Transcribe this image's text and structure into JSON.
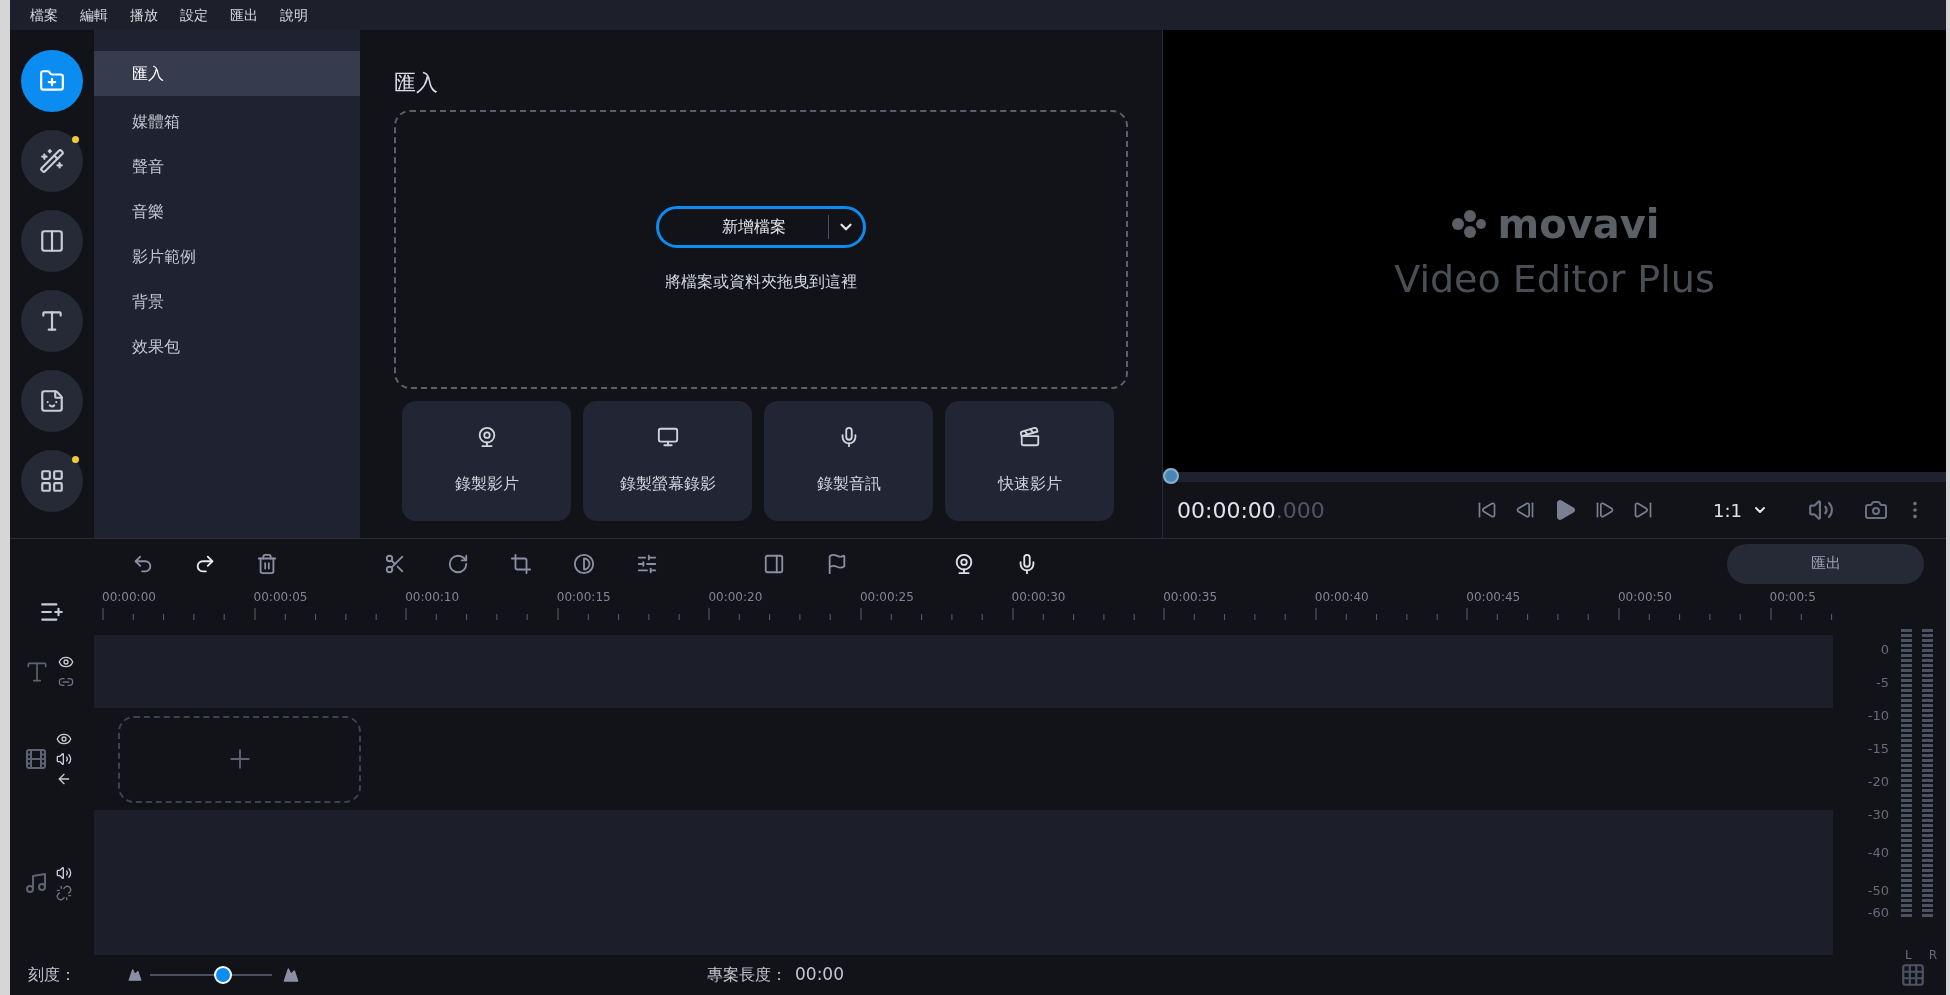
{
  "menu": [
    "檔案",
    "編輯",
    "播放",
    "設定",
    "匯出",
    "說明"
  ],
  "tools": [
    {
      "kind": "import",
      "selected": true,
      "badge": false
    },
    {
      "kind": "magic",
      "selected": false,
      "badge": true
    },
    {
      "kind": "transition",
      "selected": false,
      "badge": false
    },
    {
      "kind": "text",
      "selected": false,
      "badge": false
    },
    {
      "kind": "sticker",
      "selected": false,
      "badge": false
    },
    {
      "kind": "more",
      "selected": false,
      "badge": true
    }
  ],
  "categories": [
    {
      "label": "匯入",
      "selected": true
    },
    {
      "label": "媒體箱",
      "selected": false
    },
    {
      "label": "聲音",
      "selected": false
    },
    {
      "label": "音樂",
      "selected": false
    },
    {
      "label": "影片範例",
      "selected": false
    },
    {
      "label": "背景",
      "selected": false
    },
    {
      "label": "效果包",
      "selected": false
    }
  ],
  "import_panel": {
    "title": "匯入",
    "add_button": "新增檔案",
    "drop_hint": "將檔案或資料夾拖曳到這裡",
    "record_buttons": [
      {
        "kind": "webcam",
        "label": "錄製影片"
      },
      {
        "kind": "screen",
        "label": "錄製螢幕錄影"
      },
      {
        "kind": "mic",
        "label": "錄製音訊"
      },
      {
        "kind": "quick",
        "label": "快速影片"
      }
    ]
  },
  "preview": {
    "logo": "movavi",
    "product": "Video Editor Plus",
    "timecode": "00:00:00",
    "timecode_ms": ".000",
    "level": 0,
    "zoom": "1:1"
  },
  "export_button": "匯出",
  "ruler": [
    "00:00:00",
    "00:00:05",
    "00:00:10",
    "00:00:15",
    "00:00:20",
    "00:00:25",
    "00:00:30",
    "00:00:35",
    "00:00:40",
    "00:00:45",
    "00:00:50",
    "00:00:5"
  ],
  "tracks": [
    {
      "kind": "text"
    },
    {
      "kind": "video"
    },
    {
      "kind": "audio"
    }
  ],
  "meter": {
    "scale": [
      "0",
      "-5",
      "-10",
      "-15",
      "-20",
      "-30",
      "-40",
      "-50",
      "-60"
    ],
    "channels": [
      "L",
      "R"
    ]
  },
  "status": {
    "scale_label": "刻度：",
    "level": 0.6,
    "length_label": "專案長度：",
    "length": "00:00"
  }
}
